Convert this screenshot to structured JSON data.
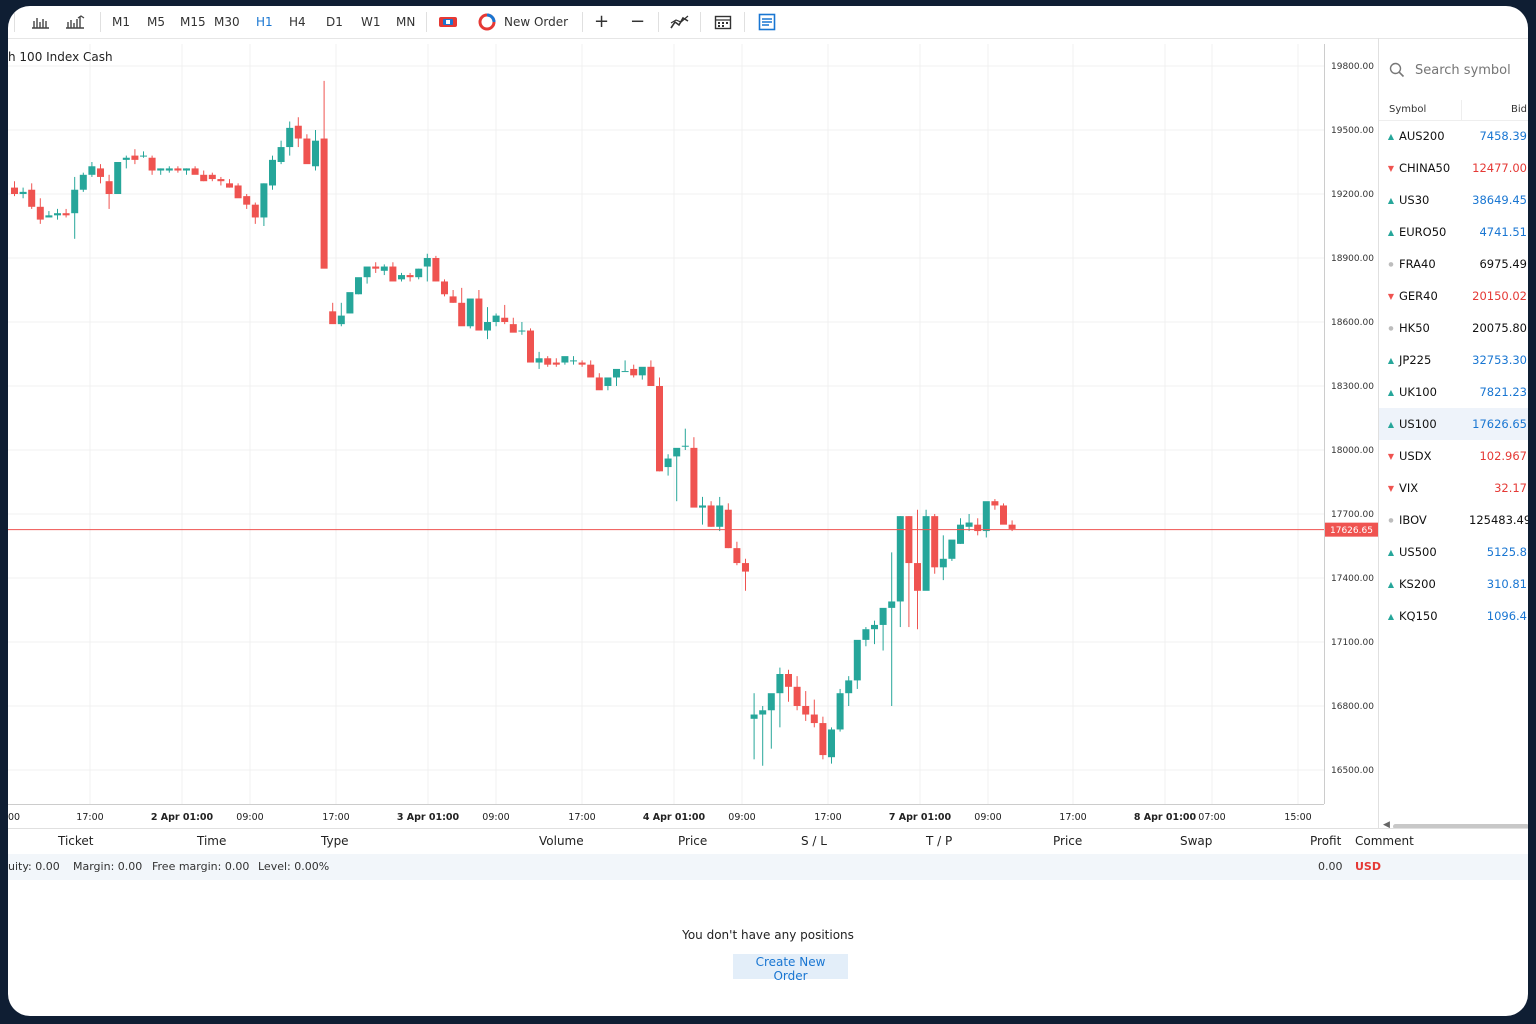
{
  "toolbar": {
    "timeframes": [
      "M1",
      "M5",
      "M15",
      "M30",
      "H1",
      "H4",
      "D1",
      "W1",
      "MN"
    ],
    "active_timeframe": "H1",
    "new_order_label": "New Order"
  },
  "chart": {
    "title": "h 100 Index Cash",
    "current_price_label": "17626.65"
  },
  "chart_data": {
    "type": "candlestick",
    "symbol": "US100",
    "title": "h 100 Index Cash",
    "ylim": [
      16300,
      19900
    ],
    "y_ticks": [
      16500,
      16800,
      17100,
      17400,
      17700,
      18000,
      18300,
      18600,
      18900,
      19200,
      19500,
      19800
    ],
    "y_tick_labels": [
      "16500.00",
      "16800.00",
      "17100.00",
      "17400.00",
      "17700.00",
      "18000.00",
      "18300.00",
      "18600.00",
      "18900.00",
      "19200.00",
      "19500.00",
      "19800.00"
    ],
    "x_tick_labels": [
      "00",
      "17:00",
      "2 Apr 01:00",
      "09:00",
      "17:00",
      "3 Apr 01:00",
      "09:00",
      "17:00",
      "4 Apr 01:00",
      "09:00",
      "17:00",
      "7 Apr 01:00",
      "09:00",
      "17:00",
      "8 Apr 01:00",
      "07:00",
      "15:00"
    ],
    "current_price": 17626.65,
    "candles": [
      [
        19230,
        19260,
        19190,
        19200
      ],
      [
        19200,
        19230,
        19180,
        19210
      ],
      [
        19220,
        19250,
        19130,
        19140
      ],
      [
        19140,
        19180,
        19060,
        19080
      ],
      [
        19090,
        19120,
        19090,
        19100
      ],
      [
        19100,
        19130,
        19080,
        19110
      ],
      [
        19110,
        19130,
        19090,
        19100
      ],
      [
        19110,
        19280,
        18990,
        19220
      ],
      [
        19220,
        19300,
        19210,
        19290
      ],
      [
        19290,
        19350,
        19280,
        19330
      ],
      [
        19320,
        19340,
        19250,
        19280
      ],
      [
        19260,
        19290,
        19130,
        19200
      ],
      [
        19200,
        19340,
        19200,
        19350
      ],
      [
        19360,
        19380,
        19320,
        19370
      ],
      [
        19380,
        19410,
        19340,
        19360
      ],
      [
        19380,
        19400,
        19370,
        19380
      ],
      [
        19370,
        19380,
        19290,
        19310
      ],
      [
        19310,
        19320,
        19290,
        19320
      ],
      [
        19310,
        19330,
        19300,
        19320
      ],
      [
        19320,
        19330,
        19300,
        19310
      ],
      [
        19310,
        19320,
        19290,
        19320
      ],
      [
        19320,
        19330,
        19300,
        19290
      ],
      [
        19290,
        19310,
        19260,
        19260
      ],
      [
        19290,
        19300,
        19260,
        19270
      ],
      [
        19270,
        19280,
        19240,
        19260
      ],
      [
        19250,
        19270,
        19230,
        19230
      ],
      [
        19240,
        19250,
        19190,
        19180
      ],
      [
        19190,
        19200,
        19130,
        19150
      ],
      [
        19150,
        19160,
        19060,
        19090
      ],
      [
        19090,
        19250,
        19050,
        19250
      ],
      [
        19240,
        19380,
        19220,
        19360
      ],
      [
        19350,
        19450,
        19340,
        19420
      ],
      [
        19420,
        19540,
        19380,
        19510
      ],
      [
        19520,
        19560,
        19420,
        19460
      ],
      [
        19460,
        19480,
        19350,
        19340
      ],
      [
        19330,
        19500,
        19310,
        19450
      ],
      [
        19460,
        19730,
        18860,
        18850
      ],
      [
        18650,
        18690,
        18600,
        18590
      ],
      [
        18590,
        18690,
        18580,
        18630
      ],
      [
        18640,
        18680,
        18640,
        18740
      ],
      [
        18730,
        18800,
        18730,
        18810
      ],
      [
        18810,
        18840,
        18780,
        18860
      ],
      [
        18860,
        18880,
        18830,
        18850
      ],
      [
        18840,
        18870,
        18820,
        18860
      ],
      [
        18860,
        18880,
        18810,
        18790
      ],
      [
        18800,
        18830,
        18790,
        18820
      ],
      [
        18820,
        18830,
        18790,
        18810
      ],
      [
        18810,
        18850,
        18800,
        18850
      ],
      [
        18860,
        18920,
        18790,
        18900
      ],
      [
        18900,
        18910,
        18790,
        18790
      ],
      [
        18790,
        18800,
        18720,
        18730
      ],
      [
        18720,
        18750,
        18690,
        18690
      ],
      [
        18690,
        18760,
        18590,
        18580
      ],
      [
        18580,
        18700,
        18570,
        18710
      ],
      [
        18710,
        18750,
        18580,
        18560
      ],
      [
        18560,
        18670,
        18520,
        18600
      ],
      [
        18600,
        18640,
        18580,
        18630
      ],
      [
        18620,
        18680,
        18590,
        18600
      ],
      [
        18590,
        18620,
        18560,
        18550
      ],
      [
        18560,
        18600,
        18540,
        18560
      ],
      [
        18560,
        18570,
        18420,
        18410
      ],
      [
        18410,
        18460,
        18380,
        18430
      ],
      [
        18430,
        18440,
        18390,
        18400
      ],
      [
        18410,
        18430,
        18390,
        18400
      ],
      [
        18410,
        18430,
        18400,
        18440
      ],
      [
        18420,
        18440,
        18400,
        18420
      ],
      [
        18410,
        18420,
        18390,
        18400
      ],
      [
        18400,
        18420,
        18390,
        18340
      ],
      [
        18340,
        18360,
        18320,
        18280
      ],
      [
        18300,
        18330,
        18280,
        18340
      ],
      [
        18340,
        18350,
        18300,
        18380
      ],
      [
        18370,
        18420,
        18370,
        18370
      ],
      [
        18380,
        18400,
        18340,
        18350
      ],
      [
        18350,
        18380,
        18330,
        18390
      ],
      [
        18390,
        18420,
        18360,
        18300
      ],
      [
        18300,
        18340,
        17900,
        17900
      ],
      [
        17920,
        17980,
        17880,
        17960
      ],
      [
        17970,
        17990,
        17760,
        18010
      ],
      [
        18020,
        18100,
        18000,
        18020
      ],
      [
        18010,
        18060,
        17750,
        17730
      ],
      [
        17730,
        17780,
        17650,
        17740
      ],
      [
        17740,
        17760,
        17640,
        17640
      ],
      [
        17640,
        17780,
        17620,
        17740
      ],
      [
        17720,
        17750,
        17540,
        17540
      ],
      [
        17540,
        17570,
        17460,
        17470
      ],
      [
        17470,
        17490,
        17340,
        17430
      ],
      [
        16740,
        16860,
        16550,
        16760
      ],
      [
        16760,
        16800,
        16520,
        16780
      ],
      [
        16780,
        16800,
        16600,
        16860
      ],
      [
        16860,
        16980,
        16700,
        16950
      ],
      [
        16950,
        16970,
        16820,
        16890
      ],
      [
        16890,
        16940,
        16780,
        16800
      ],
      [
        16800,
        16870,
        16730,
        16760
      ],
      [
        16760,
        16830,
        16700,
        16720
      ],
      [
        16720,
        16750,
        16550,
        16570
      ],
      [
        16560,
        16700,
        16530,
        16690
      ],
      [
        16690,
        16880,
        16680,
        16860
      ],
      [
        16860,
        16940,
        16800,
        16920
      ],
      [
        16920,
        17080,
        16880,
        17110
      ],
      [
        17110,
        17170,
        17080,
        17160
      ],
      [
        17160,
        17200,
        17090,
        17180
      ],
      [
        17180,
        17230,
        17060,
        17260
      ],
      [
        17260,
        17520,
        16800,
        17290
      ],
      [
        17290,
        17690,
        17170,
        17690
      ],
      [
        17690,
        17690,
        17170,
        17470
      ],
      [
        17470,
        17720,
        17160,
        17340
      ],
      [
        17340,
        17720,
        17350,
        17690
      ],
      [
        17690,
        17700,
        17420,
        17450
      ],
      [
        17450,
        17600,
        17390,
        17490
      ],
      [
        17490,
        17520,
        17480,
        17580
      ],
      [
        17560,
        17680,
        17560,
        17650
      ],
      [
        17640,
        17700,
        17620,
        17660
      ],
      [
        17650,
        17680,
        17600,
        17620
      ],
      [
        17620,
        17750,
        17590,
        17760
      ],
      [
        17760,
        17770,
        17720,
        17740
      ],
      [
        17740,
        17750,
        17680,
        17650
      ],
      [
        17650,
        17670,
        17620,
        17630
      ]
    ]
  },
  "sidebar": {
    "search_placeholder": "Search symbol",
    "col_symbol": "Symbol",
    "col_bid": "Bid",
    "symbols": [
      {
        "name": "AUS200",
        "bid": "7458.39",
        "dir": "up"
      },
      {
        "name": "CHINA50",
        "bid": "12477.00",
        "dir": "down"
      },
      {
        "name": "US30",
        "bid": "38649.45",
        "dir": "up"
      },
      {
        "name": "EURO50",
        "bid": "4741.51",
        "dir": "up"
      },
      {
        "name": "FRA40",
        "bid": "6975.49",
        "dir": "flat"
      },
      {
        "name": "GER40",
        "bid": "20150.02",
        "dir": "down"
      },
      {
        "name": "HK50",
        "bid": "20075.80",
        "dir": "flat"
      },
      {
        "name": "JP225",
        "bid": "32753.30",
        "dir": "up"
      },
      {
        "name": "UK100",
        "bid": "7821.23",
        "dir": "up"
      },
      {
        "name": "US100",
        "bid": "17626.65",
        "dir": "up"
      },
      {
        "name": "USDX",
        "bid": "102.967",
        "dir": "down"
      },
      {
        "name": "VIX",
        "bid": "32.17",
        "dir": "down"
      },
      {
        "name": "IBOV",
        "bid": "125483.49",
        "dir": "flat"
      },
      {
        "name": "US500",
        "bid": "5125.8",
        "dir": "up"
      },
      {
        "name": "KS200",
        "bid": "310.81",
        "dir": "up"
      },
      {
        "name": "KQ150",
        "bid": "1096.4",
        "dir": "up"
      }
    ],
    "selected": "US100"
  },
  "positions": {
    "columns": [
      "Ticket",
      "Time",
      "Type",
      "Volume",
      "Price",
      "S / L",
      "T / P",
      "Price",
      "Swap",
      "Profit",
      "Comment"
    ],
    "equity": "uity: 0.00",
    "margin": "Margin: 0.00",
    "free_margin": "Free margin: 0.00",
    "level": "Level: 0.00%",
    "profit_total": "0.00",
    "currency": "USD",
    "empty_message": "You don't have any positions",
    "create_button": "Create New Order"
  },
  "colors": {
    "up": "#26a69a",
    "down": "#ef5350",
    "flat": "#bdbdbd",
    "up_text": "#1976d2",
    "down_text": "#e53935",
    "accent": "#1976d2",
    "price_line": "#ef5350"
  }
}
